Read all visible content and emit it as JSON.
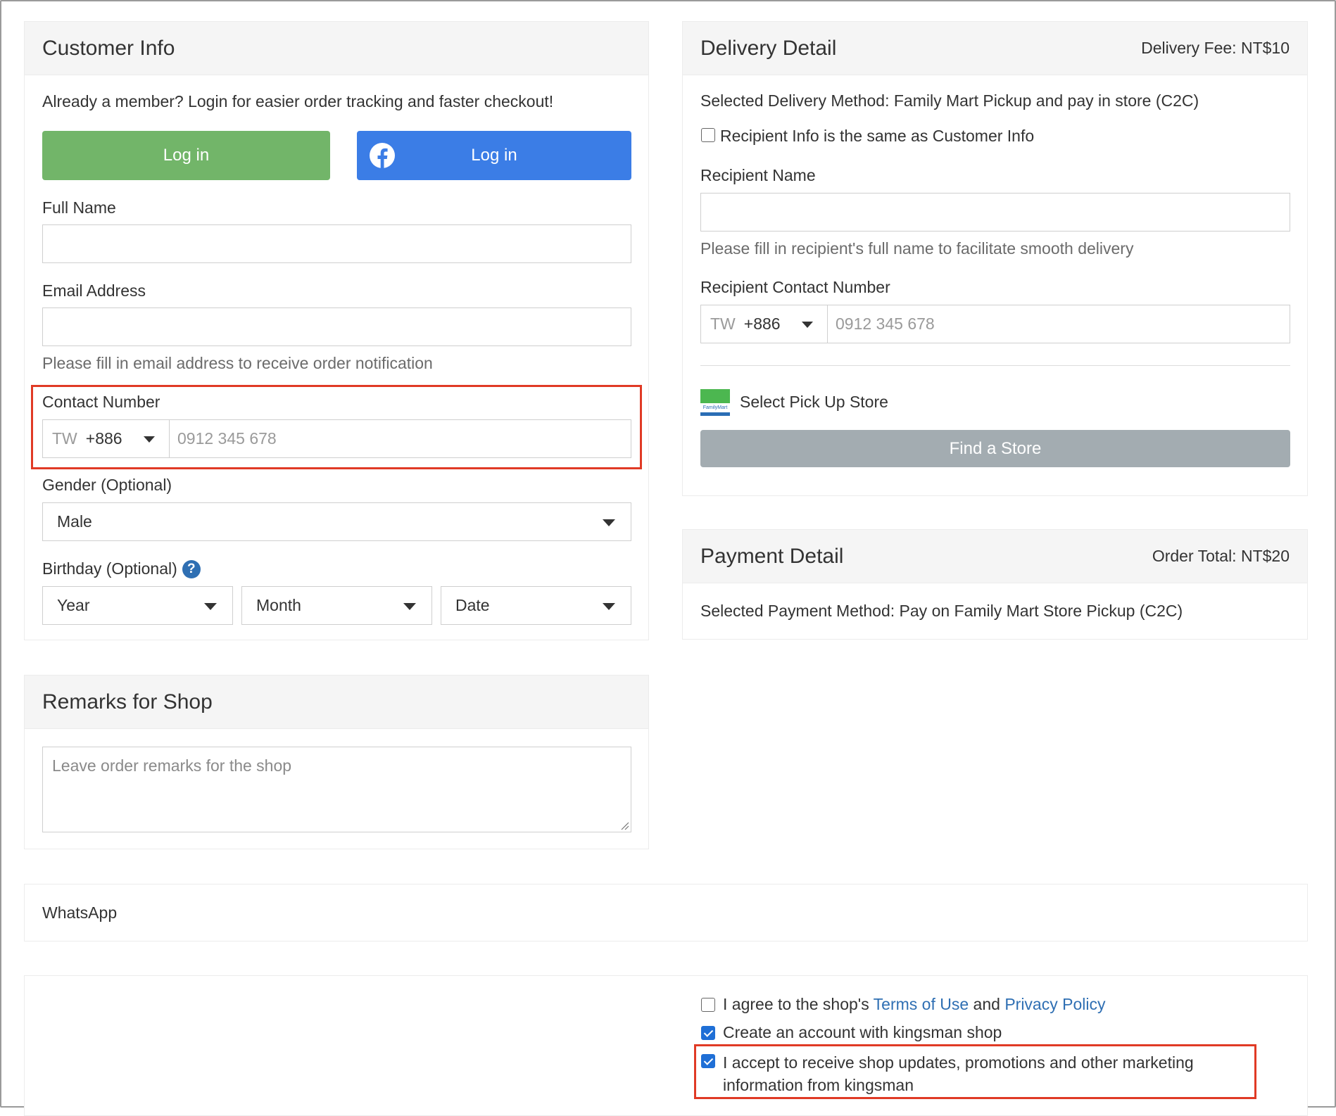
{
  "customer_info": {
    "title": "Customer Info",
    "member_prompt": "Already a member? Login for easier order tracking and faster checkout!",
    "login_label": "Log in",
    "fb_login_label": "Log in",
    "full_name_label": "Full Name",
    "full_name_value": "",
    "email_label": "Email Address",
    "email_value": "",
    "email_hint": "Please fill in email address to receive order notification",
    "contact_label": "Contact Number",
    "contact_country": "TW",
    "contact_code": "+886",
    "contact_placeholder": "0912 345 678",
    "gender_label": "Gender (Optional)",
    "gender_value": "Male",
    "birthday_label": "Birthday (Optional)",
    "year_placeholder": "Year",
    "month_placeholder": "Month",
    "date_placeholder": "Date"
  },
  "delivery": {
    "title": "Delivery Detail",
    "fee": "Delivery Fee: NT$10",
    "method": "Selected Delivery Method: Family Mart Pickup and pay in store (C2C)",
    "same_as_customer_label": "Recipient Info is the same as Customer Info",
    "recipient_name_label": "Recipient Name",
    "recipient_name_value": "",
    "recipient_name_hint": "Please fill in recipient's full name to facilitate smooth delivery",
    "recipient_contact_label": "Recipient Contact Number",
    "recipient_country": "TW",
    "recipient_code": "+886",
    "recipient_placeholder": "0912 345 678",
    "pickup_label": "Select Pick Up Store",
    "store_logo_text": "FamilyMart",
    "find_store_label": "Find a Store"
  },
  "payment": {
    "title": "Payment Detail",
    "total": "Order Total: NT$20",
    "method": "Selected Payment Method: Pay on Family Mart Store Pickup (C2C)"
  },
  "remarks": {
    "title": "Remarks for Shop",
    "placeholder": "Leave order remarks for the shop"
  },
  "whatsapp": {
    "label": "WhatsApp"
  },
  "agreements": {
    "terms_prefix": "I agree to the shop's ",
    "terms_link": "Terms of Use",
    "terms_and": " and ",
    "privacy_link": "Privacy Policy",
    "terms_checked": false,
    "create_account_label": "Create an account with kingsman shop",
    "create_account_checked": true,
    "marketing_label": "I accept to receive shop updates, promotions and other marketing information from kingsman",
    "marketing_checked": true
  },
  "colors": {
    "login_green": "#72b569",
    "facebook_blue": "#3b7de6",
    "find_store_gray": "#a3acb1",
    "highlight_red": "#e03a25",
    "link_blue": "#2f6fb3"
  }
}
